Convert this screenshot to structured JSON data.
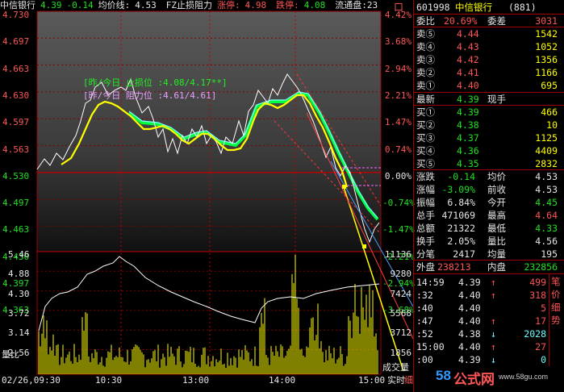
{
  "header": {
    "name": "中信银行",
    "price": "4.39",
    "change": "-0.14",
    "avg_label": "均价线:",
    "avg_value": "4.53",
    "indicator": "FZ止损阻力",
    "limit_up_label": "涨停:",
    "limit_up_value": "4.98",
    "limit_down_label": "跌停:",
    "limit_down_value": "4.08",
    "float_label": "流通盘:23",
    "right_corner": "口"
  },
  "price_axis_left": [
    "4.730",
    "4.697",
    "4.663",
    "4.630",
    "4.597",
    "4.563",
    "4.530",
    "4.497",
    "4.463",
    "4.430",
    "4.397",
    "4.363"
  ],
  "pct_axis_right": [
    "4.42%",
    "3.68%",
    "2.94%",
    "2.21%",
    "1.47%",
    "0.74%",
    "0.00%",
    "-0.74%",
    "-1.47%",
    "-2.21%",
    "-2.94%",
    "-3.68%"
  ],
  "volume_axis_left": [
    "5.46",
    "4.88",
    "4.30",
    "3.72",
    "3.14",
    "2.56"
  ],
  "volume_axis_right": [
    "11136",
    "9280",
    "7424",
    "5568",
    "3712",
    "1856"
  ],
  "volume_label": "量比",
  "volume_right_label": "成交量",
  "time_axis": [
    "02/26,09:30",
    "10:30",
    "13:00",
    "14:00",
    "15:00"
  ],
  "realtime_label": "实时",
  "detail_label": "细",
  "annotations": {
    "stop_loss": "[昨/今日 止损位 :4.08/4.17**]",
    "resistance": "[昨/今日 阻力位 :4.61/4.61]"
  },
  "quote": {
    "code": "601998",
    "name": "中信银行",
    "market_no": "(881)",
    "ratio_label": "委比",
    "ratio_value": "20.69%",
    "diff_label": "委差",
    "diff_value": "3031",
    "asks": [
      {
        "label": "卖⑤",
        "price": "4.44",
        "vol": "1542"
      },
      {
        "label": "卖④",
        "price": "4.43",
        "vol": "1052"
      },
      {
        "label": "卖③",
        "price": "4.42",
        "vol": "1356"
      },
      {
        "label": "卖②",
        "price": "4.41",
        "vol": "1166"
      },
      {
        "label": "卖①",
        "price": "4.40",
        "vol": "695"
      }
    ],
    "last_label": "最新",
    "last_price": "4.39",
    "last_hand": "现手",
    "bids": [
      {
        "label": "买①",
        "price": "4.39",
        "vol": "466"
      },
      {
        "label": "买②",
        "price": "4.38",
        "vol": "10"
      },
      {
        "label": "买③",
        "price": "4.37",
        "vol": "1125"
      },
      {
        "label": "买④",
        "price": "4.36",
        "vol": "4409"
      },
      {
        "label": "买⑤",
        "price": "4.35",
        "vol": "2832"
      }
    ],
    "stats": [
      {
        "l1": "涨跌",
        "v1": "-0.14",
        "l2": "均价",
        "v2": "4.53",
        "c1": "green",
        "c2": "white"
      },
      {
        "l1": "涨幅",
        "v1": "-3.09%",
        "l2": "前收",
        "v2": "4.53",
        "c1": "green",
        "c2": "white"
      },
      {
        "l1": "振幅",
        "v1": "6.84%",
        "l2": "今开",
        "v2": "4.45",
        "c1": "white",
        "c2": "green"
      },
      {
        "l1": "总手",
        "v1": "471069",
        "l2": "最高",
        "v2": "4.64",
        "c1": "white",
        "c2": "red"
      },
      {
        "l1": "总额",
        "v1": "21322",
        "l2": "最低",
        "v2": "4.33",
        "c1": "white",
        "c2": "green"
      },
      {
        "l1": "换手",
        "v1": "2.05%",
        "l2": "量比",
        "v2": "4.56",
        "c1": "white",
        "c2": "white"
      },
      {
        "l1": "分笔",
        "v1": "2417",
        "l2": "均量",
        "v2": "195",
        "c1": "white",
        "c2": "white"
      }
    ],
    "outer_label": "外盘",
    "outer_value": "238213",
    "inner_label": "内盘",
    "inner_value": "232856",
    "ticks": [
      {
        "time": "14:59",
        "price": "4.39",
        "dir": "↑",
        "vol": "499",
        "dc": "red"
      },
      {
        "time": ":32",
        "price": "4.40",
        "dir": "↑",
        "vol": "318",
        "dc": "red"
      },
      {
        "time": ":40",
        "price": "4.40",
        "dir": "",
        "vol": "5",
        "dc": "white"
      },
      {
        "time": ":47",
        "price": "4.40",
        "dir": "↑",
        "vol": "17",
        "dc": "red"
      },
      {
        "time": ":52",
        "price": "4.38",
        "dir": "↓",
        "vol": "2028",
        "dc": "cyan"
      },
      {
        "time": "15:00",
        "price": "4.40",
        "dir": "↑",
        "vol": "27",
        "dc": "red"
      },
      {
        "time": ":00",
        "price": "4.39",
        "dir": "↓",
        "vol": "0",
        "dc": "cyan"
      }
    ],
    "side_icons": [
      "笔",
      "价",
      "细",
      "势"
    ]
  },
  "watermark": {
    "brand_num": "58",
    "brand_text": "公式网",
    "url": "www.58gu.com"
  },
  "chart_data": {
    "type": "line",
    "x": [
      "09:30",
      "10:30",
      "11:30/13:00",
      "14:00",
      "15:00"
    ],
    "price_range": [
      4.33,
      4.73
    ],
    "pct_range": [
      "-3.68%",
      "4.42%"
    ],
    "series": [
      {
        "name": "均价线",
        "values": [
          4.53
        ]
      }
    ],
    "limit_up": 4.98,
    "limit_down": 4.08,
    "high": 4.64,
    "low": 4.33,
    "close": 4.39,
    "colors": {
      "price_line": "#ffffff",
      "avg_line": "#ffff00",
      "stop_band": "#00ff40",
      "grid": "#b00000",
      "annot_green": "#22ee22",
      "annot_purple": "#e8a0ff"
    }
  }
}
